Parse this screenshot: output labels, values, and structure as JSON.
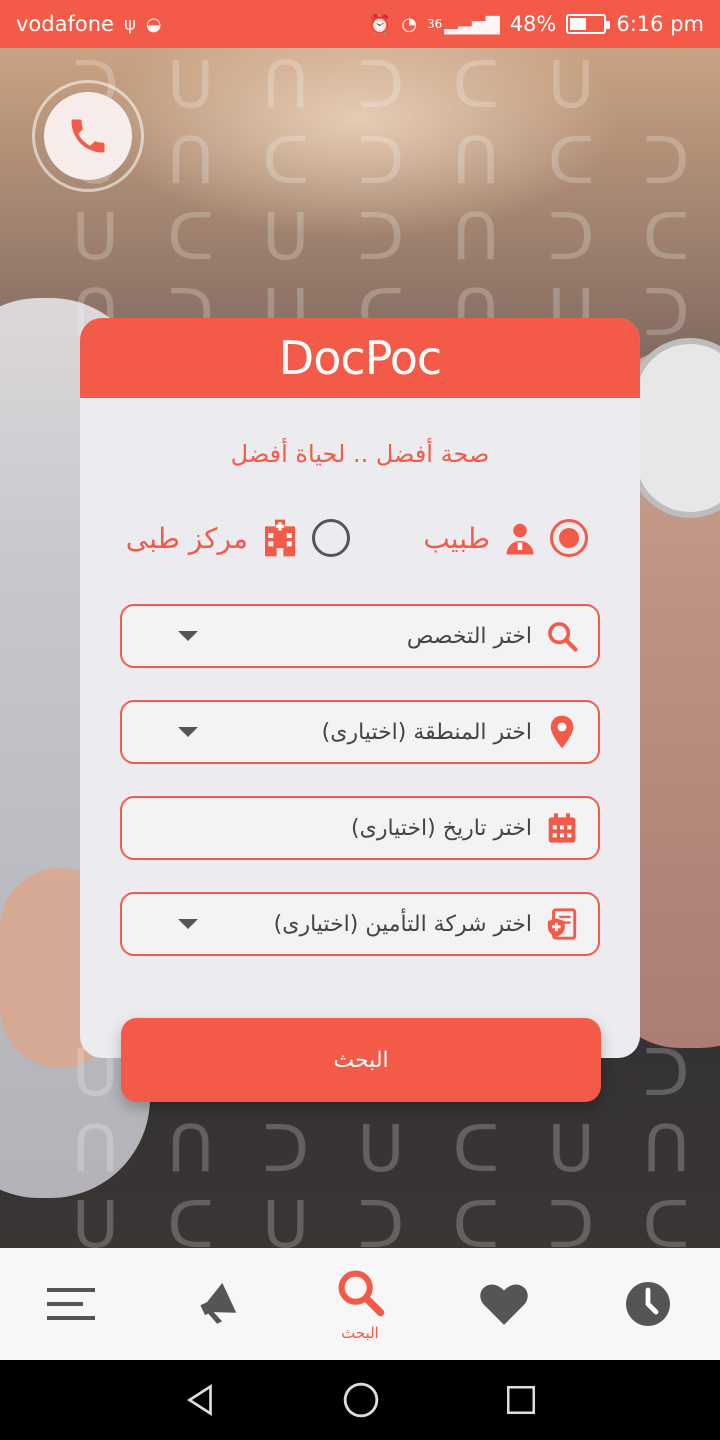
{
  "status_bar": {
    "carrier": "vodafone",
    "network": "36",
    "battery": "48%",
    "battery_level": 0.48,
    "time": "6:16 pm"
  },
  "app": {
    "logo": "DocPoc",
    "tagline": "صحة أفضل .. لحياة أفضل"
  },
  "search_type": {
    "options": [
      {
        "label": "طبيب",
        "selected": true,
        "icon": "doctor-icon"
      },
      {
        "label": "مركز طبى",
        "selected": false,
        "icon": "hospital-icon"
      }
    ]
  },
  "fields": {
    "specialty": {
      "placeholder": "اختر التخصص",
      "icon": "search-icon"
    },
    "area": {
      "placeholder": "اختر المنطقة (اختيارى)",
      "icon": "location-pin-icon"
    },
    "date": {
      "placeholder": "اختر تاريخ (اختيارى)",
      "icon": "calendar-icon"
    },
    "insurance": {
      "placeholder": "اختر شركة التأمين (اختيارى)",
      "icon": "insurance-icon"
    }
  },
  "search_button": {
    "label": "البحث"
  },
  "bottom_nav": {
    "items": [
      {
        "icon": "menu-icon"
      },
      {
        "icon": "megaphone-icon"
      },
      {
        "icon": "search-icon",
        "label": "البحث",
        "active": true
      },
      {
        "icon": "heart-icon"
      },
      {
        "icon": "clock-icon"
      }
    ]
  },
  "colors": {
    "accent": "#f45a48",
    "card_bg": "#ececf0",
    "nav_icon": "#555555"
  }
}
